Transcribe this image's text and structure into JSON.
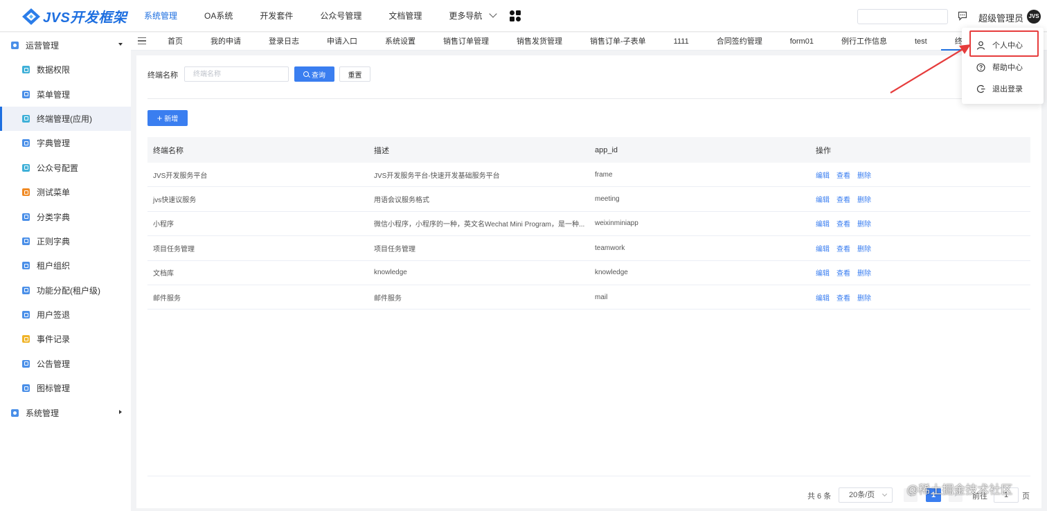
{
  "app": {
    "logo_text": "JVS开发框架",
    "username": "超级管理员",
    "avatar_text": "JVS"
  },
  "topnav": [
    {
      "label": "系统管理",
      "active": true
    },
    {
      "label": "OA系统"
    },
    {
      "label": "开发套件"
    },
    {
      "label": "公众号管理"
    },
    {
      "label": "文档管理"
    },
    {
      "label": "更多导航"
    }
  ],
  "sidebar": {
    "group1": "运营管理",
    "items": [
      {
        "label": "数据权限",
        "color": "#3fb0d8"
      },
      {
        "label": "菜单管理",
        "color": "#4a8fe8"
      },
      {
        "label": "终端管理(应用)",
        "color": "#3fb0d8",
        "active": true
      },
      {
        "label": "字典管理",
        "color": "#4a8fe8"
      },
      {
        "label": "公众号配置",
        "color": "#3fb0d8"
      },
      {
        "label": "测试菜单",
        "color": "#f08a24"
      },
      {
        "label": "分类字典",
        "color": "#4a8fe8"
      },
      {
        "label": "正则字典",
        "color": "#4a8fe8"
      },
      {
        "label": "租户组织",
        "color": "#4a8fe8"
      },
      {
        "label": "功能分配(租户级)",
        "color": "#4a8fe8"
      },
      {
        "label": "用户签退",
        "color": "#4a8fe8"
      },
      {
        "label": "事件记录",
        "color": "#f0b429"
      },
      {
        "label": "公告管理",
        "color": "#4a8fe8"
      },
      {
        "label": "图标管理",
        "color": "#4a8fe8"
      }
    ],
    "group2": "系统管理"
  },
  "tabs": [
    "首页",
    "我的申请",
    "登录日志",
    "申请入口",
    "系统设置",
    "销售订单管理",
    "销售发货管理",
    "销售订单-子表单",
    "1111",
    "合同签约管理",
    "form01",
    "例行工作信息",
    "test",
    "终端管理("
  ],
  "search": {
    "label": "终端名称",
    "placeholder": "终端名称",
    "query_label": "查询",
    "reset_label": "重置"
  },
  "add_label": "新增",
  "table": {
    "headers": [
      "终端名称",
      "描述",
      "app_id",
      "操作"
    ],
    "actions": [
      "编辑",
      "查看",
      "删除"
    ],
    "rows": [
      [
        "JVS开发服务平台",
        "JVS开发服务平台-快速开发基础服务平台",
        "frame"
      ],
      [
        "jvs快速议服务",
        "用语会议服务格式",
        "meeting"
      ],
      [
        "小程序",
        "微信小程序，小程序的一种，英文名Wechat Mini Program，是一种...",
        "weixinminiapp"
      ],
      [
        "项目任务管理",
        "项目任务管理",
        "teamwork"
      ],
      [
        "文档库",
        "knowledge",
        "knowledge"
      ],
      [
        "邮件服务",
        "邮件服务",
        "mail"
      ]
    ]
  },
  "pagination": {
    "total": "共 6 条",
    "page_size": "20条/页",
    "current": "1",
    "goto": "前往",
    "goto_value": "1",
    "page_suffix": "页",
    "prev": "‹",
    "next": "›"
  },
  "dropdown": {
    "items": [
      "个人中心",
      "帮助中心",
      "退出登录"
    ]
  },
  "watermark": "@稀土掘金技术社区",
  "colors": {
    "accent": "#1e6fe0",
    "primary_button": "#3a7ef0",
    "annotation_red": "#e63c3c"
  }
}
